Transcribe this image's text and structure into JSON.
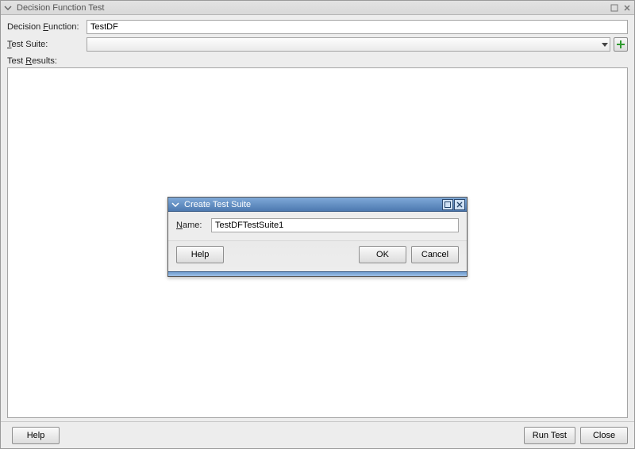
{
  "main": {
    "title": "Decision Function Test",
    "labels": {
      "decisionFunction": "Decision Function:",
      "testSuite": "Test Suite:",
      "testResults": "Test Results:"
    },
    "values": {
      "decisionFunction": "TestDF",
      "testSuite": ""
    },
    "buttons": {
      "help": "Help",
      "runTest": "Run Test",
      "close": "Close"
    }
  },
  "dialog": {
    "title": "Create Test Suite",
    "nameLabel": "Name:",
    "nameValue": "TestDFTestSuite1",
    "buttons": {
      "help": "Help",
      "ok": "OK",
      "cancel": "Cancel"
    }
  }
}
